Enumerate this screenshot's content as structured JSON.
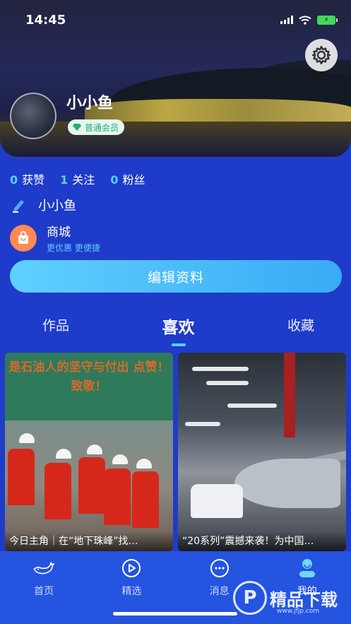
{
  "status_bar": {
    "time": "14:45"
  },
  "profile": {
    "username": "小小鱼",
    "member_badge": "普通会员",
    "stats": [
      {
        "count": "0",
        "label": "获赞"
      },
      {
        "count": "1",
        "label": "关注"
      },
      {
        "count": "0",
        "label": "粉丝"
      }
    ],
    "nickname": "小小鱼"
  },
  "mall": {
    "title": "商城",
    "subtitle": "更优惠 更便捷"
  },
  "edit_button": {
    "label": "编辑资料"
  },
  "tabs": [
    {
      "label": "作品",
      "active": false
    },
    {
      "label": "喜欢",
      "active": true
    },
    {
      "label": "收藏",
      "active": false
    }
  ],
  "cards": [
    {
      "image_text": "是石油人的坚守与付出 点赞！致敬！",
      "caption": "今日主角｜在“地下珠峰”找…"
    },
    {
      "caption": "“20系列”震撼来袭！为中国…"
    }
  ],
  "bottom_nav": [
    {
      "label": "首页",
      "icon": "whale-icon"
    },
    {
      "label": "精选",
      "icon": "play-icon"
    },
    {
      "label": "消息",
      "icon": "chat-icon"
    },
    {
      "label": "我的",
      "icon": "user-icon",
      "active": true
    }
  ],
  "watermark": {
    "title": "精品下载",
    "url": "www.jfjp.com"
  },
  "colors": {
    "background": "#1f3bc9",
    "accent": "#53d2ff",
    "edit_button": "#5fd0ff",
    "nav_bar": "#2454e0",
    "member_badge_text": "#1fae7a",
    "mall_icon": "#ff8a55"
  }
}
